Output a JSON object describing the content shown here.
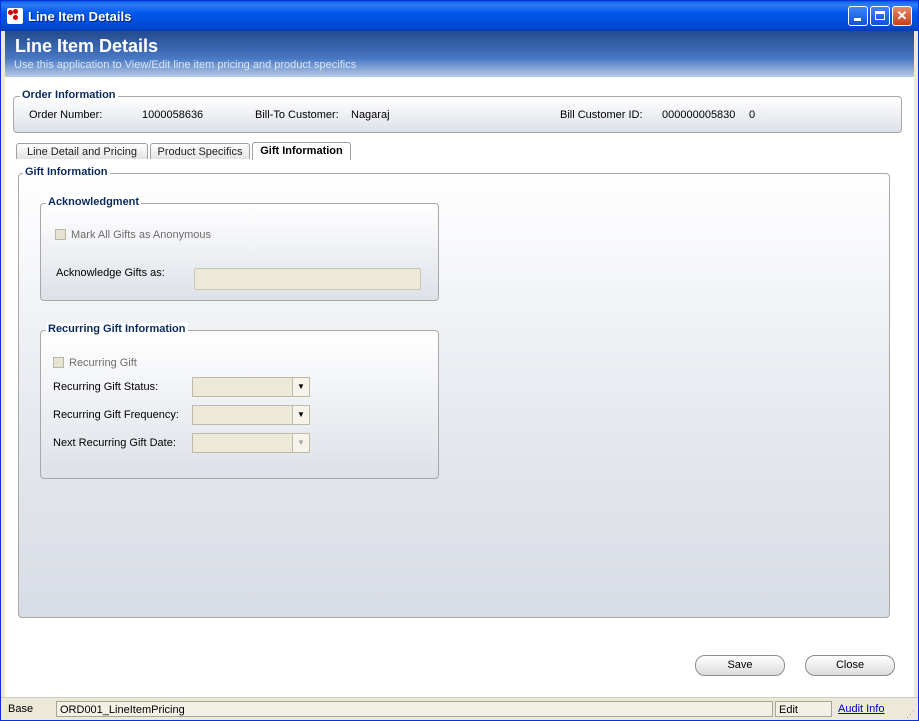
{
  "window": {
    "title": "Line Item Details"
  },
  "header": {
    "title": "Line Item Details",
    "subtitle": "Use this application to View/Edit line item pricing and product specifics"
  },
  "order_info": {
    "legend": "Order Information",
    "order_number_label": "Order Number:",
    "order_number": "1000058636",
    "bill_to_label": "Bill-To Customer:",
    "bill_to": "Nagaraj",
    "bill_id_label": "Bill Customer ID:",
    "bill_id": "000000005830",
    "bill_id_suffix": "0"
  },
  "tabs": [
    {
      "label": "Line Detail and Pricing",
      "active": false
    },
    {
      "label": "Product Specifics",
      "active": false
    },
    {
      "label": "Gift Information",
      "active": true
    }
  ],
  "gift_info": {
    "legend": "Gift Information",
    "acknowledgment": {
      "legend": "Acknowledgment",
      "anonymous_label": "Mark All Gifts as Anonymous",
      "acknowledge_as_label": "Acknowledge Gifts as:",
      "acknowledge_as_value": ""
    },
    "recurring": {
      "legend": "Recurring Gift Information",
      "recurring_label": "Recurring Gift",
      "status_label": "Recurring Gift Status:",
      "status_value": "",
      "frequency_label": "Recurring Gift Frequency:",
      "frequency_value": "",
      "next_date_label": "Next Recurring Gift Date:",
      "next_date_value": ""
    }
  },
  "buttons": {
    "save": "Save",
    "close": "Close"
  },
  "statusbar": {
    "base": "Base",
    "app_id": "ORD001_LineItemPricing",
    "mode": "Edit",
    "audit": "Audit Info"
  },
  "colors": {
    "titlebar": "#0058ee",
    "header_top": "#234a8f",
    "legend_text": "#0b2a5c",
    "link": "#0000cc"
  }
}
